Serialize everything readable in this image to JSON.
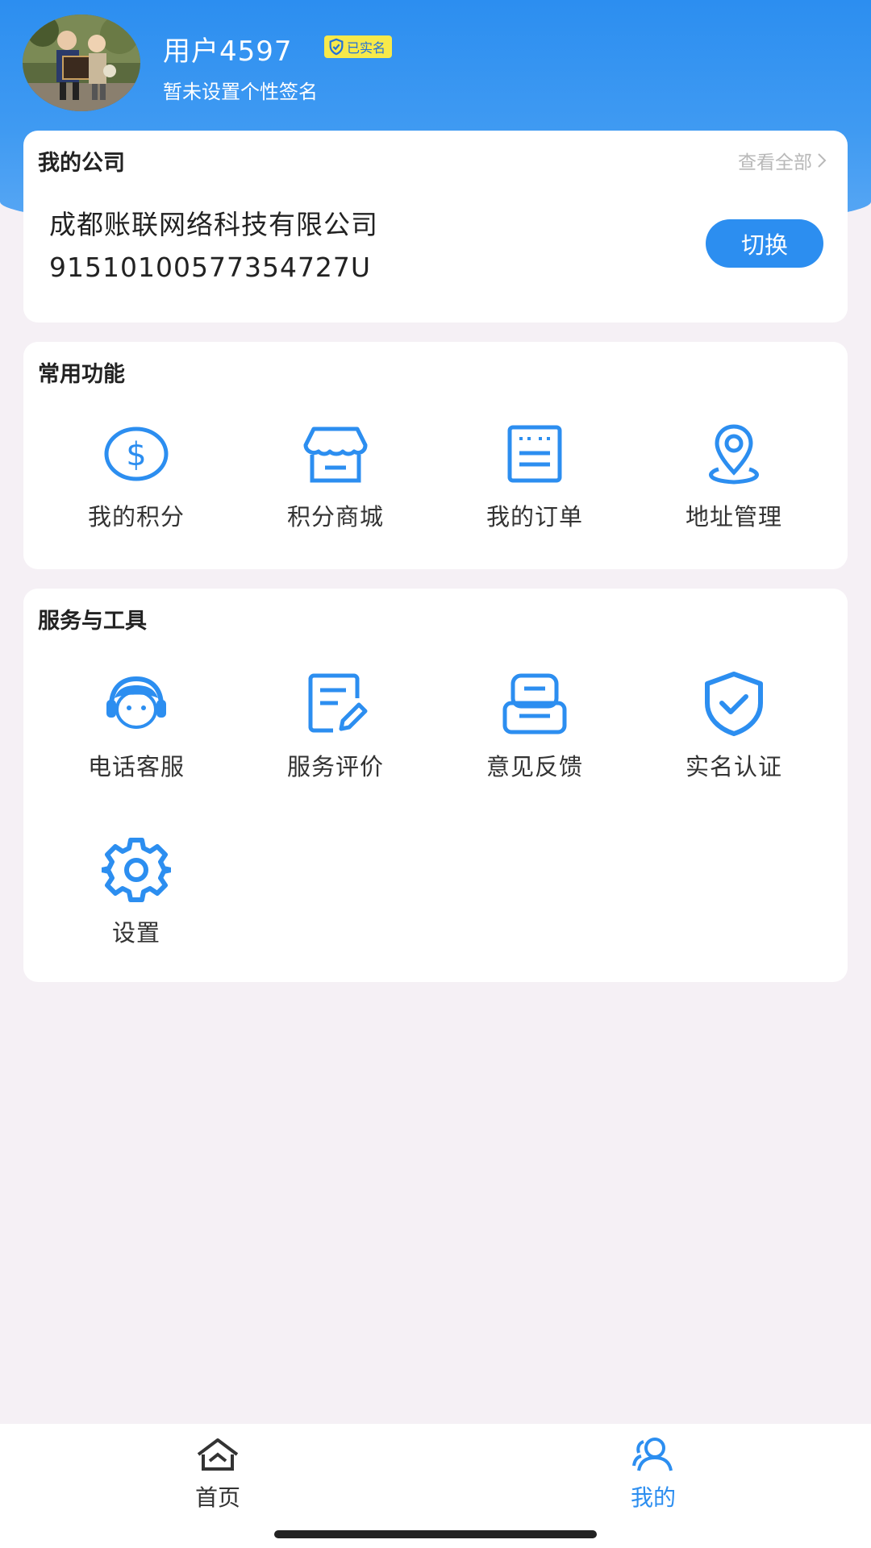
{
  "colors": {
    "primary": "#2c8ef0",
    "badge_bg": "#f7e94a",
    "page_bg": "#f5f0f5"
  },
  "profile": {
    "name": "用户4597",
    "badge": "已实名",
    "signature": "暂未设置个性签名"
  },
  "company_card": {
    "title": "我的公司",
    "view_all": "查看全部",
    "company_name": "成都账联网络科技有限公司",
    "credit_code": "91510100577354727U",
    "switch_label": "切换"
  },
  "common_functions": {
    "title": "常用功能",
    "items": [
      {
        "label": "我的积分",
        "icon": "points-icon"
      },
      {
        "label": "积分商城",
        "icon": "store-icon"
      },
      {
        "label": "我的订单",
        "icon": "order-icon"
      },
      {
        "label": "地址管理",
        "icon": "location-icon"
      }
    ]
  },
  "services": {
    "title": "服务与工具",
    "items": [
      {
        "label": "电话客服",
        "icon": "headset-icon"
      },
      {
        "label": "服务评价",
        "icon": "review-icon"
      },
      {
        "label": "意见反馈",
        "icon": "feedback-icon"
      },
      {
        "label": "实名认证",
        "icon": "shield-check-icon"
      },
      {
        "label": "设置",
        "icon": "gear-icon"
      }
    ]
  },
  "tabbar": {
    "items": [
      {
        "label": "首页",
        "icon": "home-icon",
        "active": false
      },
      {
        "label": "我的",
        "icon": "user-icon",
        "active": true
      }
    ]
  }
}
